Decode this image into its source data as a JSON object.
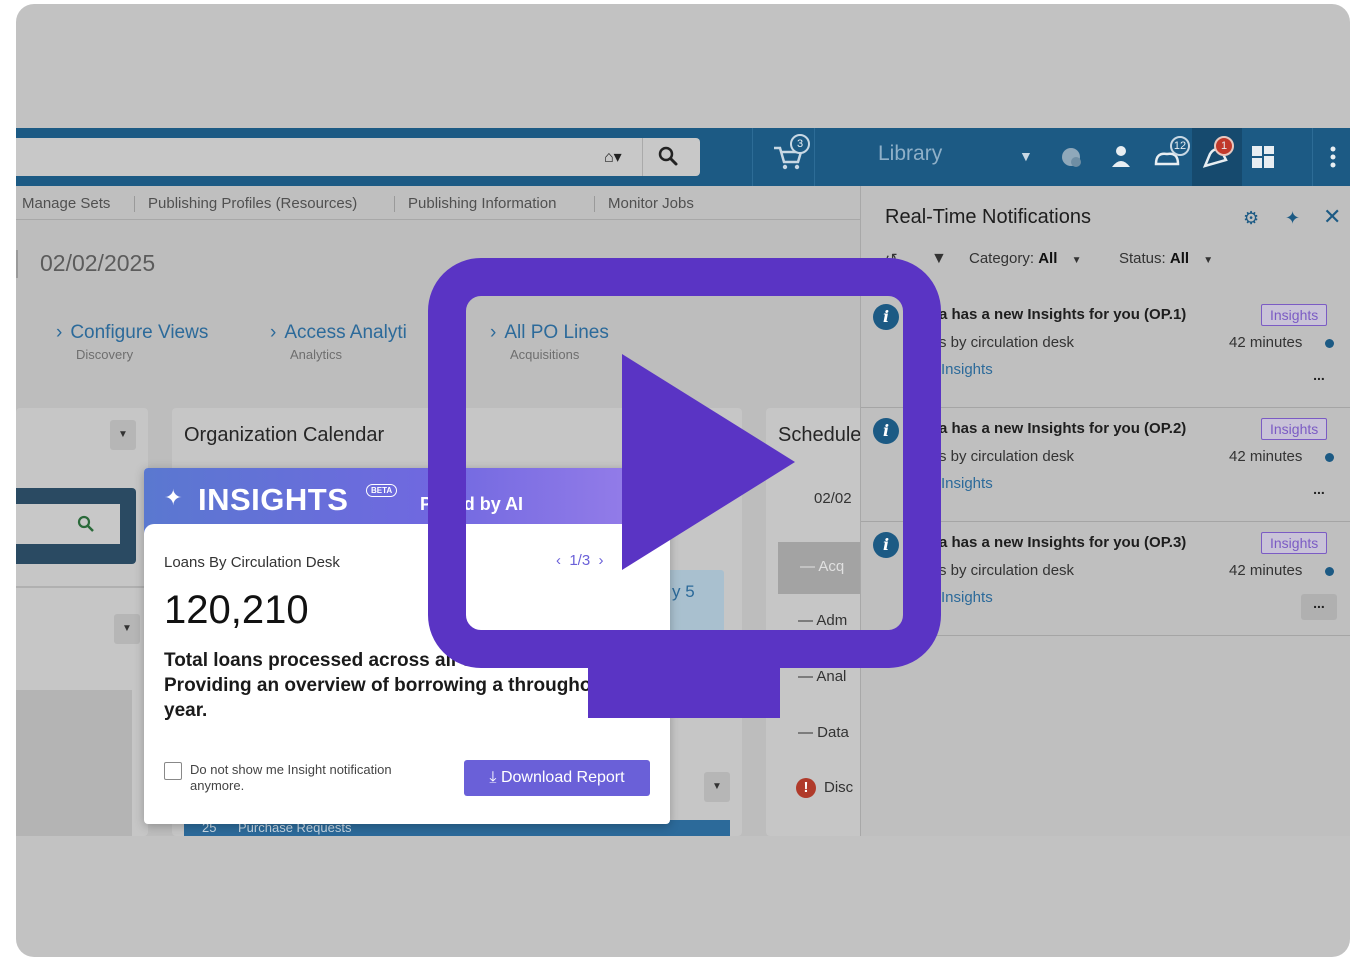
{
  "topbar": {
    "library_label": "Library",
    "cart_badge": "3",
    "tasks_badge": "12",
    "alerts_badge": "1"
  },
  "menu": {
    "items": [
      "Manage Sets",
      "Publishing Profiles (Resources)",
      "Publishing Information",
      "Monitor Jobs"
    ]
  },
  "date": "02/02/2025",
  "quick_links": [
    {
      "title": "Configure Views",
      "sub": "Discovery"
    },
    {
      "title": "Access Analyti",
      "sub": "Analytics"
    },
    {
      "title": "All PO Lines",
      "sub": "Acquisitions"
    }
  ],
  "widgets": {
    "org_calendar": "Organization Calendar",
    "schedule": "Schedule",
    "schedule_date": "02/02",
    "schedule_items": [
      "Acq",
      "Adm",
      "Anal",
      "Data",
      "Disc"
    ],
    "count_5": "y 5",
    "purchase_count": "25",
    "purchase_label": "Purchase Requests"
  },
  "notifications": {
    "title": "Real-Time Notifications",
    "filter_category_label": "Category:",
    "filter_category_value": "All",
    "filter_status_label": "Status:",
    "filter_status_value": "All",
    "items": [
      {
        "head": "a has a new Insights for you (OP.1)",
        "sub": "s by circulation desk",
        "link": "Insights",
        "tag": "Insights",
        "time": "42 minutes",
        "more": "..."
      },
      {
        "head": "a has a new Insights for you (OP.2)",
        "sub": "s by circulation desk",
        "link": "Insights",
        "tag": "Insights",
        "time": "42 minutes",
        "more": "..."
      },
      {
        "head": "a has a new Insights for you (OP.3)",
        "sub": "s by circulation desk",
        "link": "Insights",
        "tag": "Insights",
        "time": "42 minutes",
        "more": "..."
      }
    ]
  },
  "insights": {
    "word": "INSIGHTS",
    "beta": "BETA",
    "powered": "P    ered by AI",
    "card_title": "Loans By Circulation Desk",
    "pager": "1/3",
    "number": "120,210",
    "description": "Total loans processed across all circulation d in 2024. Providing an overview of borrowing a throughout the year.",
    "checkbox_label": "Do not show me Insight notification anymore.",
    "download_label": "Download Report"
  },
  "colors": {
    "brand": "#1c5a84",
    "play_overlay": "#5a34c4",
    "insights_accent": "#6a60d8"
  }
}
